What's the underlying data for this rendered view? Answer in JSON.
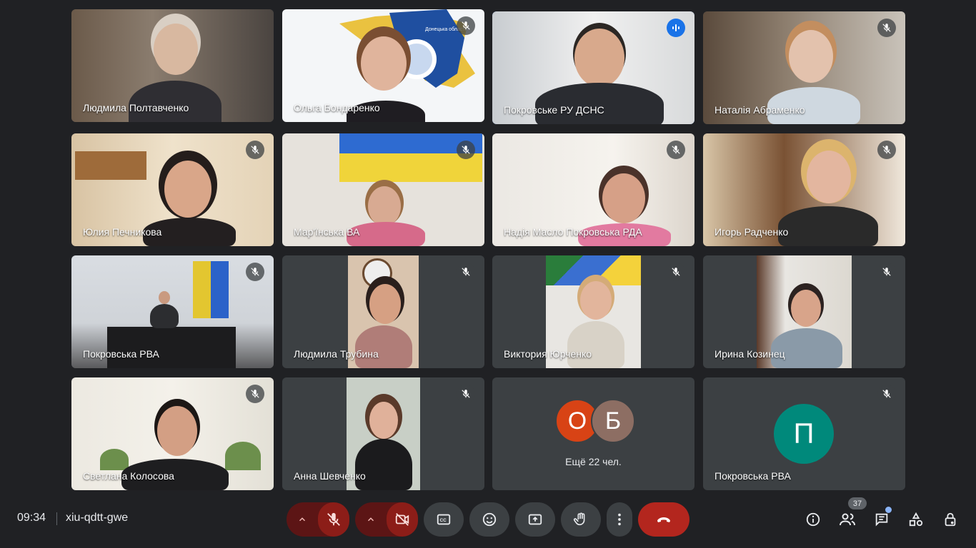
{
  "participants": [
    {
      "name": "Людмила Полтавченко"
    },
    {
      "name": "Ольга Бондаренко"
    },
    {
      "name": "Покровське РУ ДСНС"
    },
    {
      "name": "Наталія Абраменко"
    },
    {
      "name": "Юлия Печникова"
    },
    {
      "name": "Мар'їнська ВА"
    },
    {
      "name": "Надія Масло Покровська РДА"
    },
    {
      "name": "Игорь Радченко"
    },
    {
      "name": "Покровська РВА"
    },
    {
      "name": "Людмила Трубина"
    },
    {
      "name": "Виктория Юрченко"
    },
    {
      "name": "Ирина Козинец"
    },
    {
      "name": "Светлана Колосова"
    },
    {
      "name": "Анна Шевченко"
    },
    {
      "name": "Покровська РВА",
      "avatar_letter": "П",
      "avatar_color": "#00897b"
    }
  ],
  "overflow_tile": {
    "avatars": [
      {
        "letter": "О",
        "color": "#d84315"
      },
      {
        "letter": "Б",
        "color": "#8d6e63"
      }
    ],
    "label": "Ещё 22 чел."
  },
  "logo_text": "Донецька область",
  "meeting": {
    "time": "09:34",
    "code": "xiu-qdtt-gwe"
  },
  "controls": {
    "mic_state": "off",
    "camera_state": "off",
    "icons": [
      "chevron-up-icon",
      "mic-off-icon",
      "camera-off-icon",
      "captions-icon",
      "emoji-icon",
      "present-icon",
      "raise-hand-icon",
      "more-options-icon",
      "end-call-icon"
    ]
  },
  "right_panel": {
    "people_count": "37",
    "icons": [
      "info-icon",
      "people-icon",
      "chat-icon",
      "activities-icon",
      "host-controls-icon"
    ]
  },
  "colors": {
    "background": "#202124",
    "tile": "#3c4043",
    "active_border": "#1a56c4",
    "end_call": "#b3261e"
  }
}
